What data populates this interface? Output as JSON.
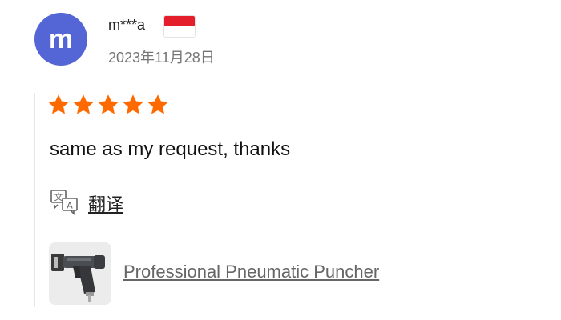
{
  "reviewer": {
    "avatar_letter": "m",
    "avatar_color": "#5465d6",
    "name": "m***a",
    "flag_icon": "indonesia-flag-icon",
    "date": "2023年11月28日"
  },
  "review": {
    "rating": 5,
    "rating_max": 5,
    "star_color": "#ff6a00",
    "text": "same as my request, thanks"
  },
  "translate": {
    "icon": "translate-icon",
    "label": "翻译"
  },
  "product": {
    "thumbnail_icon": "pneumatic-puncher-image",
    "name": "Professional Pneumatic Puncher"
  }
}
